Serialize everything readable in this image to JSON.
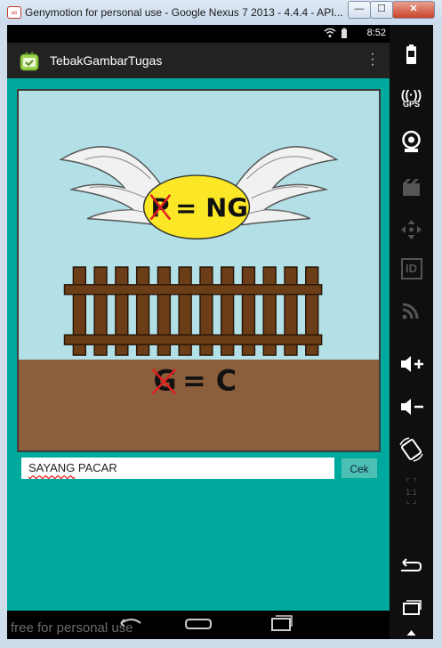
{
  "window": {
    "title": "Genymotion for personal use - Google Nexus 7 2013 - 4.4.4 - API...",
    "minimize_glyph": "—",
    "maximize_glyph": "☐",
    "close_glyph": "✕"
  },
  "statusbar": {
    "time": "8:52",
    "icons": "wifi-icon battery-icon"
  },
  "actionbar": {
    "title": "TebakGambarTugas"
  },
  "puzzle": {
    "top_text": "= NG",
    "top_crossed_letter": "P",
    "bottom_text": "= C",
    "bottom_crossed_letter": "G",
    "colors": {
      "sky": "#b2e0e6",
      "ground": "#8b5e3c",
      "fence": "#6b3e17",
      "oval": "#fbe725"
    }
  },
  "answer": {
    "word1": "SAYANG",
    "word2": " PACAR"
  },
  "check_button": {
    "label": "Cek"
  },
  "watermark": "free for personal use",
  "sidepanel": {
    "gps_label": "GPS",
    "id_label": "ID",
    "ratio_label": "1:1"
  }
}
